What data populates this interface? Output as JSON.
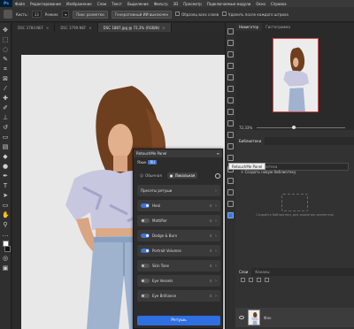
{
  "menubar": {
    "logo": "Ps",
    "items": [
      "Файл",
      "Редактирование",
      "Изображение",
      "Слои",
      "Текст",
      "Выделение",
      "Фильтр",
      "3D",
      "Просмотр",
      "Подключаемые модули",
      "Окно",
      "Справка"
    ]
  },
  "options": {
    "size_label": "Кисть:",
    "size_value": "13",
    "mode_label": "Режим:",
    "sample_btn": "Пикс разметки",
    "ai_btn": "Генеративный ИИ выключен",
    "sample_all": "Образец всех слоев",
    "remove_label": "Удалить после каждого штриха"
  },
  "tabs": [
    {
      "label": "DSC 3784.NEF",
      "active": false
    },
    {
      "label": "DSC 3799.NEF",
      "active": false
    },
    {
      "label": "DSC 1887.jpg @ 72,3% (RGB/8)",
      "active": true
    }
  ],
  "navigator": {
    "tabs": [
      "Навигатор",
      "Гистограмма"
    ],
    "zoom": "72,33%"
  },
  "libraries": {
    "title": "Библиотеки",
    "add_new": "Создать новую библиотеку",
    "search_placeholder": "Ваша библиотека",
    "empty_text": "Создайте библиотеку для хранения элементов"
  },
  "tooltip": "RetouchMe Panel",
  "layers": {
    "tabs": [
      "Слои",
      "Каналы"
    ],
    "layer_name": "Фон"
  },
  "retouch": {
    "title": "RetouchMe Panel",
    "language_label": "Язык",
    "language_value": "RU",
    "tab_basic": "Обычная",
    "tab_advanced": "Локальная",
    "preset_label": "Пресеты ретуши",
    "items": [
      {
        "name": "Heal",
        "on": true
      },
      {
        "name": "Mattifier",
        "on": false
      },
      {
        "name": "Dodge & Burn",
        "on": true
      },
      {
        "name": "Portrait Volumes",
        "on": true
      },
      {
        "name": "Skin Tone",
        "on": false
      },
      {
        "name": "Eye Vessels",
        "on": false
      },
      {
        "name": "Eye Brilliance",
        "on": false
      }
    ],
    "apply_label": "Ретушь"
  },
  "colors": {
    "accent": "#2f6fe0",
    "panel": "#2c2c2c",
    "background": "#262626"
  }
}
